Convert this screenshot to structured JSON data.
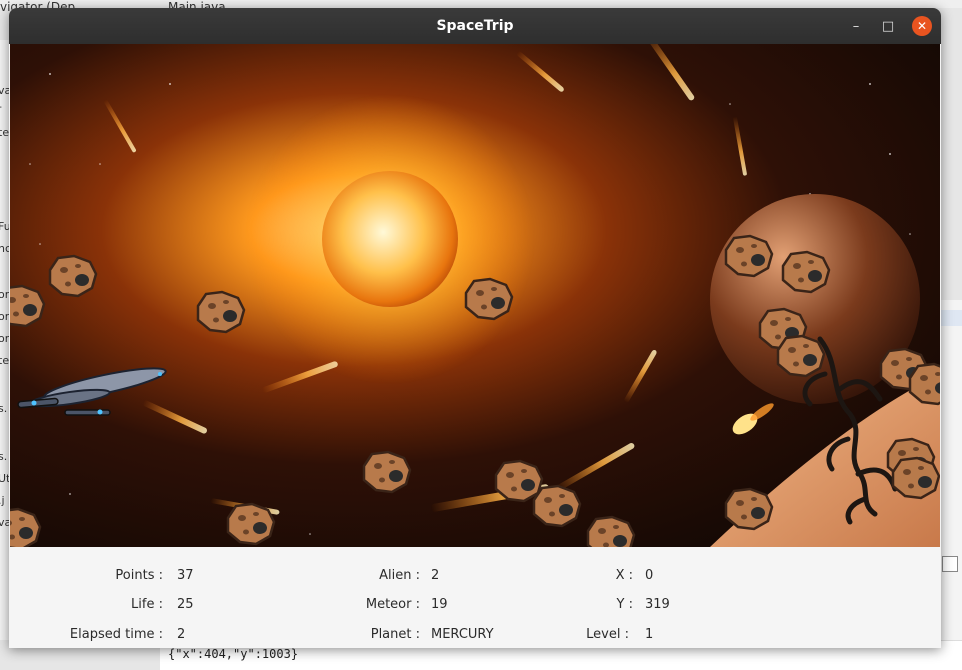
{
  "window": {
    "title": "SpaceTrip"
  },
  "background": {
    "tab_navigator": "vigator (Dep",
    "tab_main": "Main.java",
    "left_fragments": [
      "va",
      "-",
      "te",
      "Fu",
      "nc",
      "or",
      "on",
      "on",
      "te",
      "s.",
      "s.",
      "Ut",
      ".j",
      "va"
    ],
    "console_lines": [
      "{\"x\":404,\"y\":1003}"
    ]
  },
  "hud": {
    "points_label": "Points :",
    "points": "37",
    "life_label": "Life :",
    "life": "25",
    "elapsed_label": "Elapsed time :",
    "elapsed": "2",
    "alien_label": "Alien :",
    "alien": "2",
    "meteor_label": "Meteor :",
    "meteor": "19",
    "planet_label": "Planet :",
    "planet": "MERCURY",
    "x_label": "X :",
    "x": "0",
    "y_label": "Y :",
    "y": "319",
    "level_label": "Level :",
    "level": "1"
  },
  "icons": [
    "minimize-icon",
    "maximize-icon",
    "close-icon",
    "spaceship-icon",
    "meteor-icon",
    "alien-icon"
  ],
  "colors": {
    "titlebar": "#2e2e2e",
    "close_button": "#e95420",
    "meteor": "#b87a4b"
  }
}
